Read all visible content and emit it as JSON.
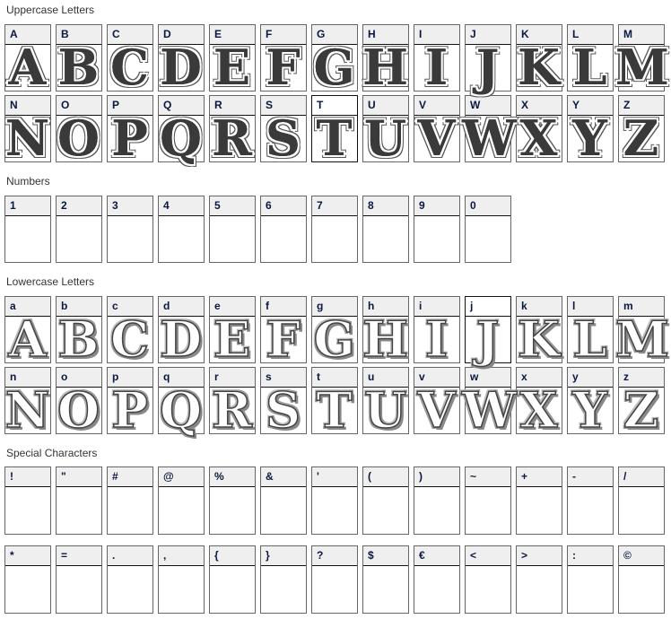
{
  "sections": {
    "uppercase": {
      "title": "Uppercase Letters",
      "row1": [
        "A",
        "B",
        "C",
        "D",
        "E",
        "F",
        "G",
        "H",
        "I",
        "J",
        "K",
        "L",
        "M"
      ],
      "row2": [
        "N",
        "O",
        "P",
        "Q",
        "R",
        "S",
        "T",
        "U",
        "V",
        "W",
        "X",
        "Y",
        "Z"
      ],
      "hovered": "T",
      "preview_style": "dark"
    },
    "numbers": {
      "title": "Numbers",
      "row1": [
        "1",
        "2",
        "3",
        "4",
        "5",
        "6",
        "7",
        "8",
        "9",
        "0"
      ]
    },
    "lowercase": {
      "title": "Lowercase Letters",
      "row1": [
        "a",
        "b",
        "c",
        "d",
        "e",
        "f",
        "g",
        "h",
        "i",
        "j",
        "k",
        "l",
        "m"
      ],
      "row2": [
        "n",
        "o",
        "p",
        "q",
        "r",
        "s",
        "t",
        "u",
        "v",
        "w",
        "x",
        "y",
        "z"
      ],
      "hovered": "j",
      "preview_style": "light"
    },
    "special": {
      "title": "Special Characters",
      "row1": [
        "!",
        "\"",
        "#",
        "@",
        "%",
        "&",
        "'",
        "(",
        ")",
        "~",
        "+",
        "-",
        "/"
      ],
      "row2": [
        "*",
        "=",
        ".",
        ",",
        "{",
        "}",
        "?",
        "$",
        "€",
        "<",
        ">",
        ":",
        "©"
      ]
    }
  },
  "colors": {
    "header_bg": "#efefef",
    "label_color": "#0a1740",
    "cell_border": "#666666"
  }
}
